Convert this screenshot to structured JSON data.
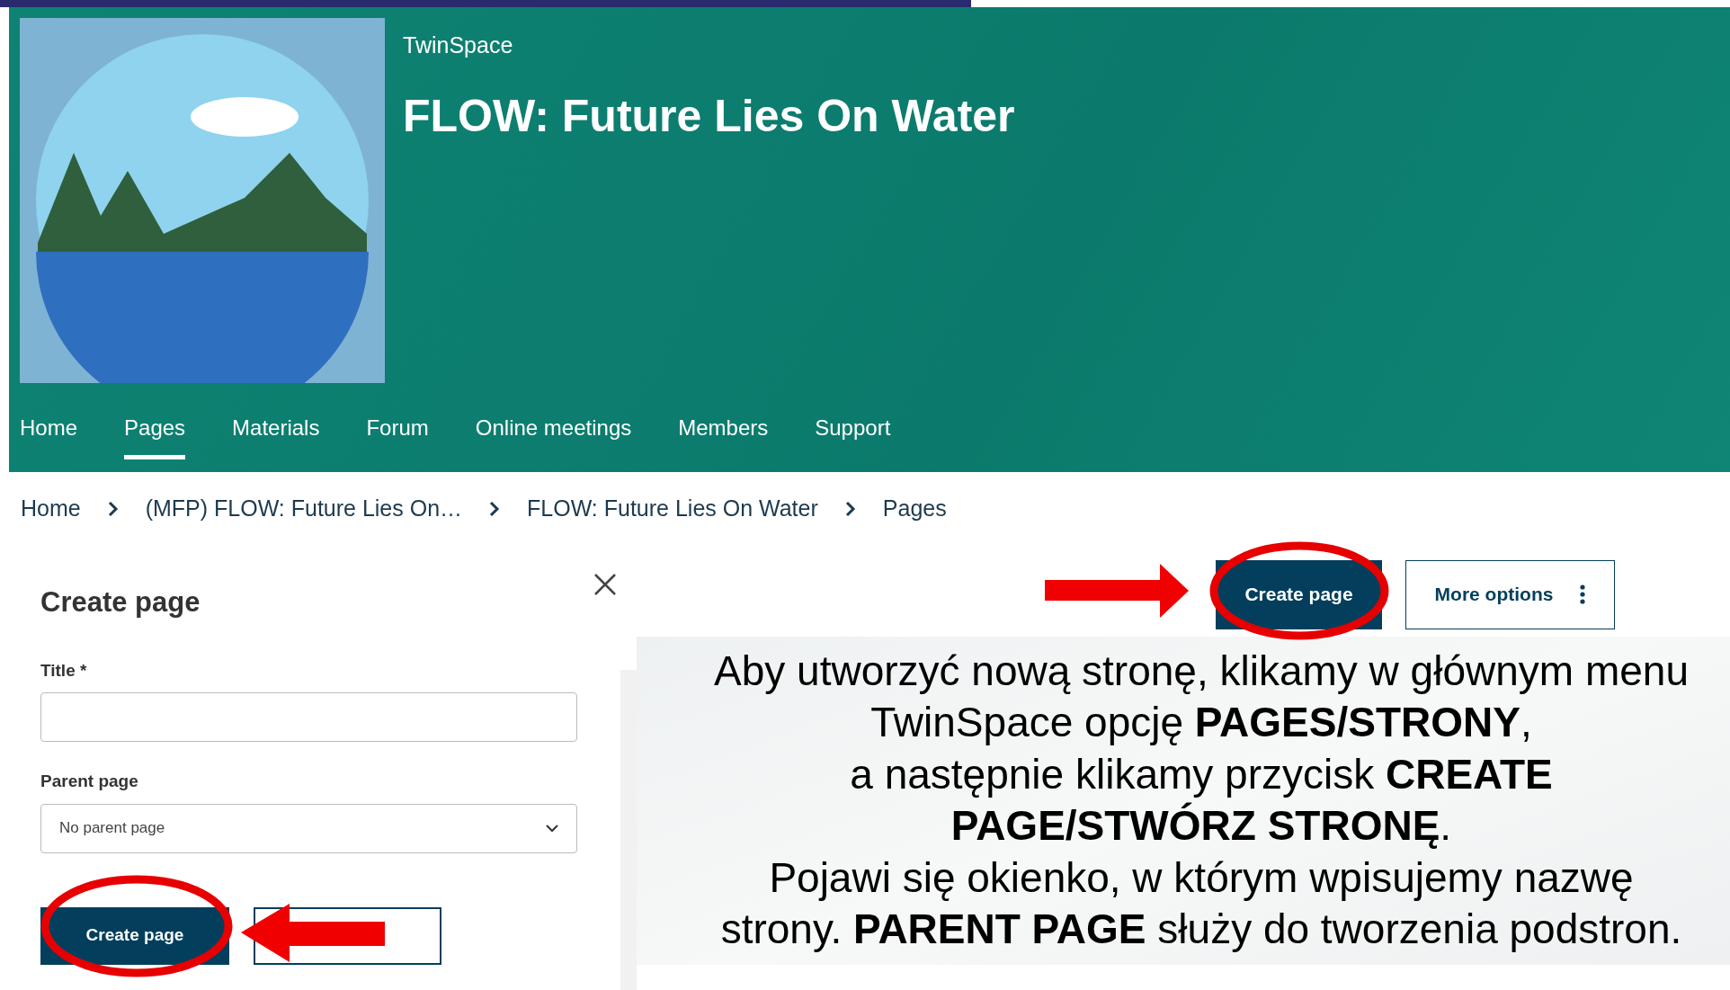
{
  "header": {
    "site_label": "TwinSpace",
    "title": "FLOW: Future Lies On Water"
  },
  "nav": [
    {
      "label": "Home",
      "selected": false
    },
    {
      "label": "Pages",
      "selected": true
    },
    {
      "label": "Materials",
      "selected": false
    },
    {
      "label": "Forum",
      "selected": false
    },
    {
      "label": "Online meetings",
      "selected": false
    },
    {
      "label": "Members",
      "selected": false
    },
    {
      "label": "Support",
      "selected": false
    }
  ],
  "breadcrumb": [
    "Home",
    "(MFP) FLOW: Future Lies On…",
    "FLOW: Future Lies On Water",
    "Pages"
  ],
  "dialog": {
    "title": "Create page",
    "fields": [
      {
        "kind": "text",
        "label": "Title *"
      },
      {
        "kind": "select",
        "label": "Parent page",
        "value": "No parent page"
      }
    ],
    "primary_button": "Create page"
  },
  "toolbar": {
    "create_button": "Create page",
    "more_button": "More options"
  },
  "instructions": [
    "Aby utworzyć nową stronę, klikamy w głównym menu",
    "TwinSpace opcję **PAGES/STRONY**,",
    "a następnie klikamy przycisk **CREATE**",
    "**PAGE/STWÓRZ STRONĘ**.",
    "Pojawi się okienko, w którym wpisujemy nazwę",
    "strony. **PARENT PAGE** służy do tworzenia podstron."
  ]
}
